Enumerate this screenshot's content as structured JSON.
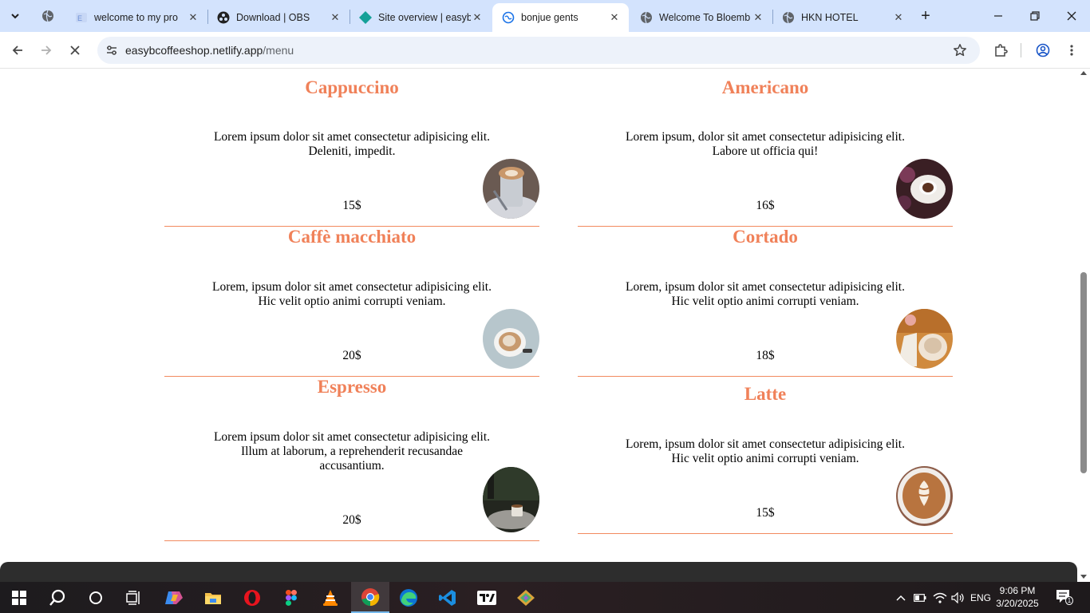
{
  "browser": {
    "tabs": [
      {
        "title": "welcome to my pro",
        "favicon": "elementor-icon"
      },
      {
        "title": "Download | OBS",
        "favicon": "obs-icon"
      },
      {
        "title": "Site overview | easyb",
        "favicon": "netlify-icon"
      },
      {
        "title": "bonjue gents",
        "favicon": "loading-globe-icon",
        "active": true
      },
      {
        "title": "Welcome To Bloemb",
        "favicon": "globe-icon"
      },
      {
        "title": "HKN HOTEL",
        "favicon": "globe-icon"
      }
    ],
    "address": {
      "host": "easybcoffeeshop.netlify.app",
      "path": "/menu"
    }
  },
  "menu": {
    "items": [
      {
        "name": "Cappuccino",
        "desc": "Lorem ipsum dolor sit amet consectetur adipisicing elit. Deleniti, impedit.",
        "price": "15$"
      },
      {
        "name": "Americano",
        "desc": "Lorem ipsum, dolor sit amet consectetur adipisicing elit. Labore ut officia qui!",
        "price": "16$"
      },
      {
        "name": "Caffè macchiato",
        "desc": "Lorem, ipsum dolor sit amet consectetur adipisicing elit. Hic velit optio animi corrupti veniam.",
        "price": "20$"
      },
      {
        "name": "Cortado",
        "desc": "Lorem, ipsum dolor sit amet consectetur adipisicing elit. Hic velit optio animi corrupti veniam.",
        "price": "18$"
      },
      {
        "name": "Espresso",
        "desc": "Lorem ipsum dolor sit amet consectetur adipisicing elit. Illum at laborum, a reprehenderit recusandae accusantium.",
        "price": "20$"
      },
      {
        "name": "Latte",
        "desc": "Lorem, ipsum dolor sit amet consectetur adipisicing elit. Hic velit optio animi corrupti veniam.",
        "price": "15$"
      }
    ]
  },
  "taskbar": {
    "apps": [
      "start-icon",
      "search-icon",
      "cortana-icon",
      "task-view-icon",
      "copilot-icon",
      "file-explorer-icon",
      "opera-icon",
      "figma-icon",
      "vlc-icon",
      "chrome-icon",
      "edge-icon",
      "vscode-icon",
      "tradingview-icon",
      "app-icon"
    ],
    "language": "ENG",
    "time": "9:06 PM",
    "date": "3/20/2025",
    "notification_count": "1"
  },
  "colors": {
    "accent": "#f08159",
    "divider": "#f28a5f",
    "tabstrip": "#d3e3fd",
    "omnibox": "#edf2fa"
  }
}
